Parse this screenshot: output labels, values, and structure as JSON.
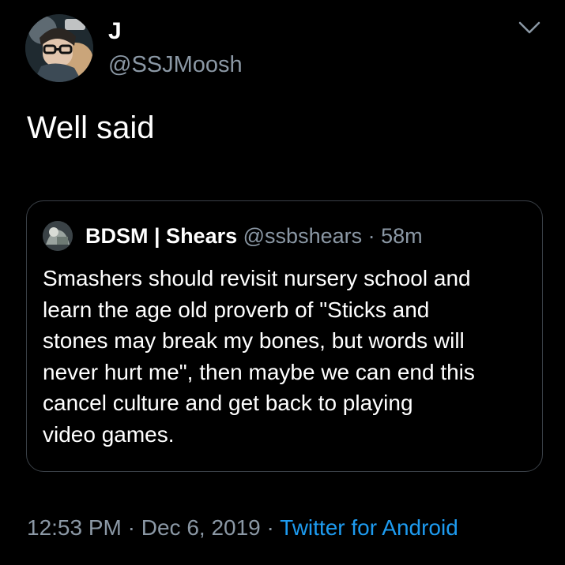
{
  "author": {
    "display_name": "J",
    "handle": "@SSJMoosh"
  },
  "tweet": {
    "text": "Well said"
  },
  "quoted": {
    "name": "BDSM | Shears",
    "handle": "@ssbshears",
    "separator": "·",
    "time": "58m",
    "lines": [
      "Smashers should revisit nursery school and",
      "learn the age old proverb of \"Sticks and",
      "stones may break my bones, but words will",
      "never hurt me\", then maybe we can end this",
      "cancel culture and get back to playing",
      "video games."
    ]
  },
  "meta": {
    "time": "12:53 PM",
    "sep1": "·",
    "date": "Dec 6, 2019",
    "sep2": "·",
    "source": "Twitter for Android"
  },
  "icons": {
    "menu": "chevron-down-icon"
  },
  "colors": {
    "background": "#000000",
    "text": "#ffffff",
    "secondary": "#8b98a5",
    "link": "#1d9bf0",
    "border": "#3a4047"
  }
}
